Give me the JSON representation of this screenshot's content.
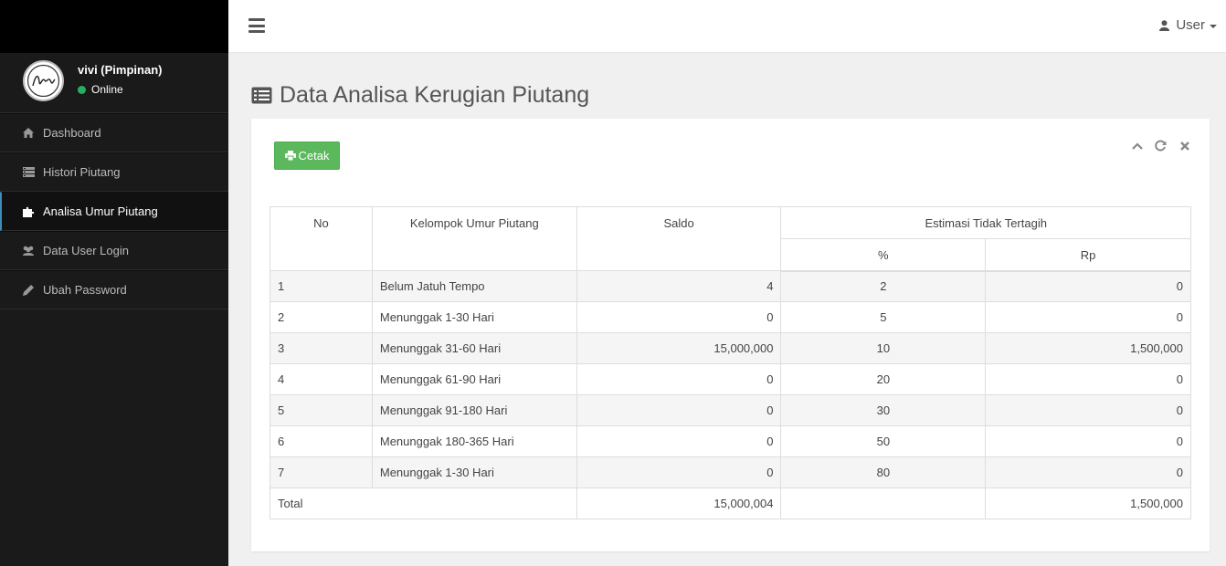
{
  "sidebar": {
    "user_name": "vivi (Pimpinan)",
    "user_status": "Online",
    "items": [
      {
        "label": "Dashboard",
        "icon": "home-icon"
      },
      {
        "label": "Histori Piutang",
        "icon": "list-icon"
      },
      {
        "label": "Analisa Umur Piutang",
        "icon": "puzzle-icon",
        "active": true
      },
      {
        "label": "Data User Login",
        "icon": "users-icon"
      },
      {
        "label": "Ubah Password",
        "icon": "pencil-icon"
      }
    ]
  },
  "header": {
    "user_label": "User"
  },
  "page": {
    "title": "Data Analisa Kerugian Piutang",
    "print_label": "Cetak"
  },
  "table": {
    "headers": {
      "no": "No",
      "kelompok": "Kelompok Umur Piutang",
      "saldo": "Saldo",
      "estimasi": "Estimasi Tidak Tertagih",
      "pct": "%",
      "rp": "Rp"
    },
    "rows": [
      {
        "no": "1",
        "kelompok": "Belum Jatuh Tempo",
        "saldo": "4",
        "pct": "2",
        "rp": "0"
      },
      {
        "no": "2",
        "kelompok": "Menunggak 1-30 Hari",
        "saldo": "0",
        "pct": "5",
        "rp": "0"
      },
      {
        "no": "3",
        "kelompok": "Menunggak 31-60 Hari",
        "saldo": "15,000,000",
        "pct": "10",
        "rp": "1,500,000"
      },
      {
        "no": "4",
        "kelompok": "Menunggak 61-90 Hari",
        "saldo": "0",
        "pct": "20",
        "rp": "0"
      },
      {
        "no": "5",
        "kelompok": "Menunggak 91-180 Hari",
        "saldo": "0",
        "pct": "30",
        "rp": "0"
      },
      {
        "no": "6",
        "kelompok": "Menunggak 180-365 Hari",
        "saldo": "0",
        "pct": "50",
        "rp": "0"
      },
      {
        "no": "7",
        "kelompok": "Menunggak 1-30 Hari",
        "saldo": "0",
        "pct": "80",
        "rp": "0"
      }
    ],
    "total": {
      "label": "Total",
      "saldo": "15,000,004",
      "rp": "1,500,000"
    }
  },
  "colors": {
    "sidebar_bg": "#1a1a1a",
    "accent_green": "#5cb85c",
    "online": "#27ae60"
  }
}
